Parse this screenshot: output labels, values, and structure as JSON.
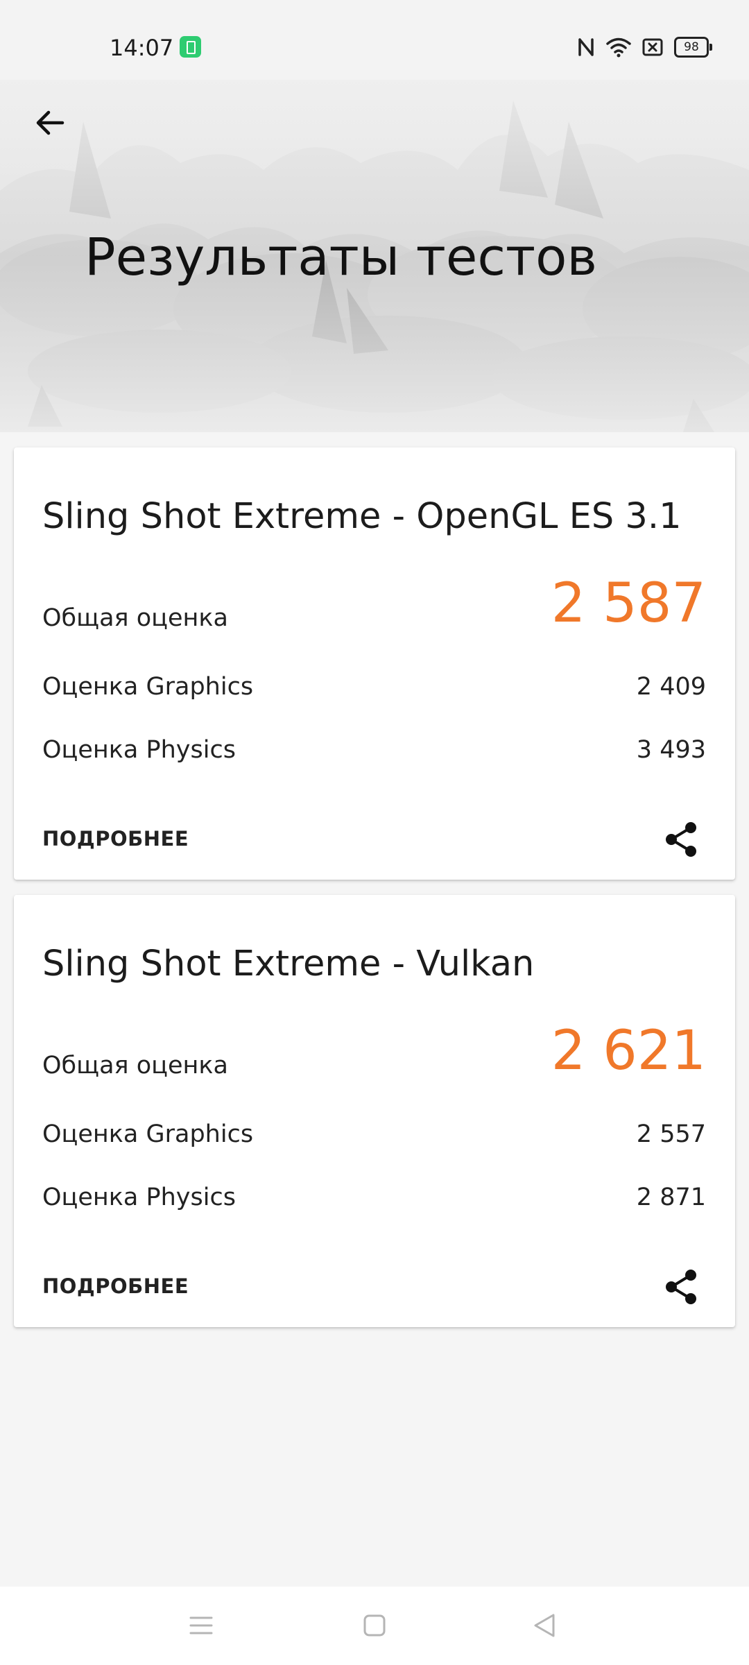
{
  "status_bar": {
    "time": "14:07",
    "battery_level": "98",
    "icons": [
      "app-notification-icon",
      "nfc-icon",
      "wifi-icon",
      "sim-off-icon",
      "battery-icon"
    ]
  },
  "header": {
    "title": "Результаты тестов",
    "back_icon": "arrow-left-icon"
  },
  "results": [
    {
      "title": "Sling Shot Extreme - OpenGL ES 3.1",
      "overall_label": "Общая оценка",
      "overall_value": "2 587",
      "graphics_label": "Оценка Graphics",
      "graphics_value": "2 409",
      "physics_label": "Оценка Physics",
      "physics_value": "3 493",
      "details_label": "ПОДРОБНЕЕ",
      "share_icon": "share-icon"
    },
    {
      "title": "Sling Shot Extreme - Vulkan",
      "overall_label": "Общая оценка",
      "overall_value": "2 621",
      "graphics_label": "Оценка Graphics",
      "graphics_value": "2 557",
      "physics_label": "Оценка Physics",
      "physics_value": "2 871",
      "details_label": "ПОДРОБНЕЕ",
      "share_icon": "share-icon"
    }
  ],
  "nav_bar": {
    "icons": [
      "menu-icon",
      "home-icon",
      "back-triangle-icon"
    ]
  },
  "colors": {
    "accent": "#f0782a",
    "background": "#f5f5f5",
    "card": "#ffffff",
    "status_app_badge": "#2ecc71"
  }
}
